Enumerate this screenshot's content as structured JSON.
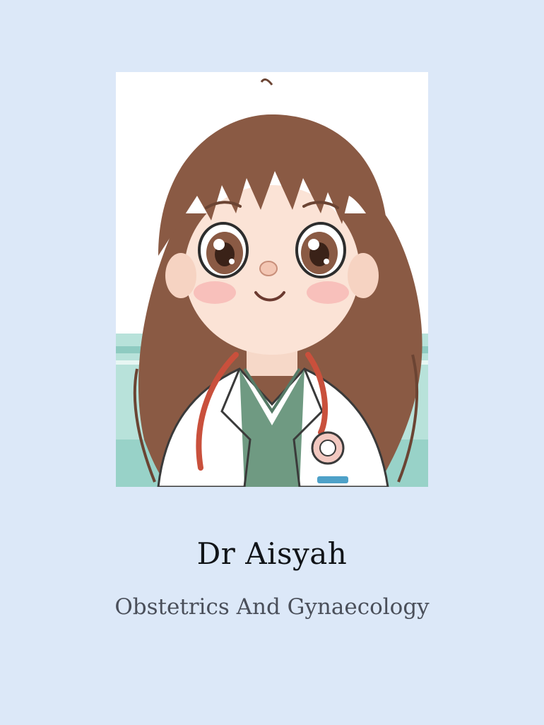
{
  "profile": {
    "name": "Dr Aisyah",
    "specialty": "Obstetrics And Gynaecology"
  },
  "colors": {
    "background": "#dce8f8",
    "name_text": "#111418",
    "specialty_text": "#4a4f5a",
    "hair": "#8a5a44",
    "coat": "#ffffff",
    "scrubs": "#6f9a82",
    "stethoscope": "#c9503c",
    "wall_stripe": "#9fd3cb"
  },
  "icons": {
    "portrait": "cartoon-doctor-portrait"
  }
}
